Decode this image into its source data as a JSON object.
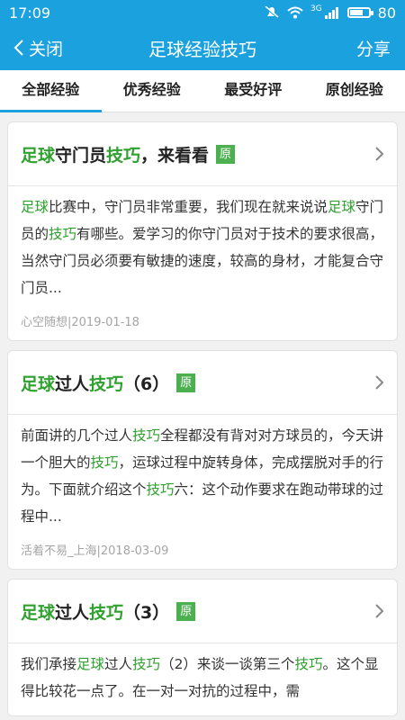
{
  "statusbar": {
    "time": "17:09",
    "battery": "80",
    "network": "3G",
    "battery_level": 0.8
  },
  "navbar": {
    "back_label": "关闭",
    "title": "足球经验技巧",
    "share_label": "分享"
  },
  "tabs": [
    {
      "label": "全部经验",
      "active": true
    },
    {
      "label": "优秀经验",
      "active": false
    },
    {
      "label": "最受好评",
      "active": false
    },
    {
      "label": "原创经验",
      "active": false
    }
  ],
  "articles": [
    {
      "title_parts": [
        {
          "t": "足球",
          "hl": true
        },
        {
          "t": "守门员",
          "hl": false
        },
        {
          "t": "技巧",
          "hl": true
        },
        {
          "t": "，来看看",
          "hl": false
        }
      ],
      "badge": "原",
      "excerpt_parts": [
        {
          "t": "足球",
          "hl": true
        },
        {
          "t": "比赛中，守门员非常重要，我们现在就来说说",
          "hl": false
        },
        {
          "t": "足球",
          "hl": true
        },
        {
          "t": "守门员的",
          "hl": false
        },
        {
          "t": "技巧",
          "hl": true
        },
        {
          "t": "有哪些。爱学习的你守门员对于技术的要求很高，当然守门员必须要有敏捷的速度，较高的身材，才能复合守门员...",
          "hl": false
        }
      ],
      "meta": "心空随想|2019-01-18"
    },
    {
      "title_parts": [
        {
          "t": "足球",
          "hl": true
        },
        {
          "t": "过人",
          "hl": false
        },
        {
          "t": "技巧",
          "hl": true
        },
        {
          "t": "（6）",
          "hl": false
        }
      ],
      "badge": "原",
      "excerpt_parts": [
        {
          "t": "前面讲的几个过人",
          "hl": false
        },
        {
          "t": "技巧",
          "hl": true
        },
        {
          "t": "全程都没有背对对方球员的，今天讲一个胆大的",
          "hl": false
        },
        {
          "t": "技巧",
          "hl": true
        },
        {
          "t": "，运球过程中旋转身体，完成摆脱对手的行为。下面就介绍这个",
          "hl": false
        },
        {
          "t": "技巧",
          "hl": true
        },
        {
          "t": "六：这个动作要求在跑动带球的过程中...",
          "hl": false
        }
      ],
      "meta": "活着不易_上海|2018-03-09"
    },
    {
      "title_parts": [
        {
          "t": "足球",
          "hl": true
        },
        {
          "t": "过人",
          "hl": false
        },
        {
          "t": "技巧",
          "hl": true
        },
        {
          "t": "（3）",
          "hl": false
        }
      ],
      "badge": "原",
      "excerpt_parts": [
        {
          "t": "我们承接",
          "hl": false
        },
        {
          "t": "足球",
          "hl": true
        },
        {
          "t": "过人",
          "hl": false
        },
        {
          "t": "技巧",
          "hl": true
        },
        {
          "t": "（2）来谈一谈第三个",
          "hl": false
        },
        {
          "t": "技巧",
          "hl": true
        },
        {
          "t": "。这个显得比较花一点了。在一对一对抗的过程中，需",
          "hl": false
        }
      ],
      "meta": ""
    }
  ],
  "colors": {
    "accent": "#1aa1de",
    "highlight": "#2ea12e",
    "badge": "#4caf50"
  }
}
